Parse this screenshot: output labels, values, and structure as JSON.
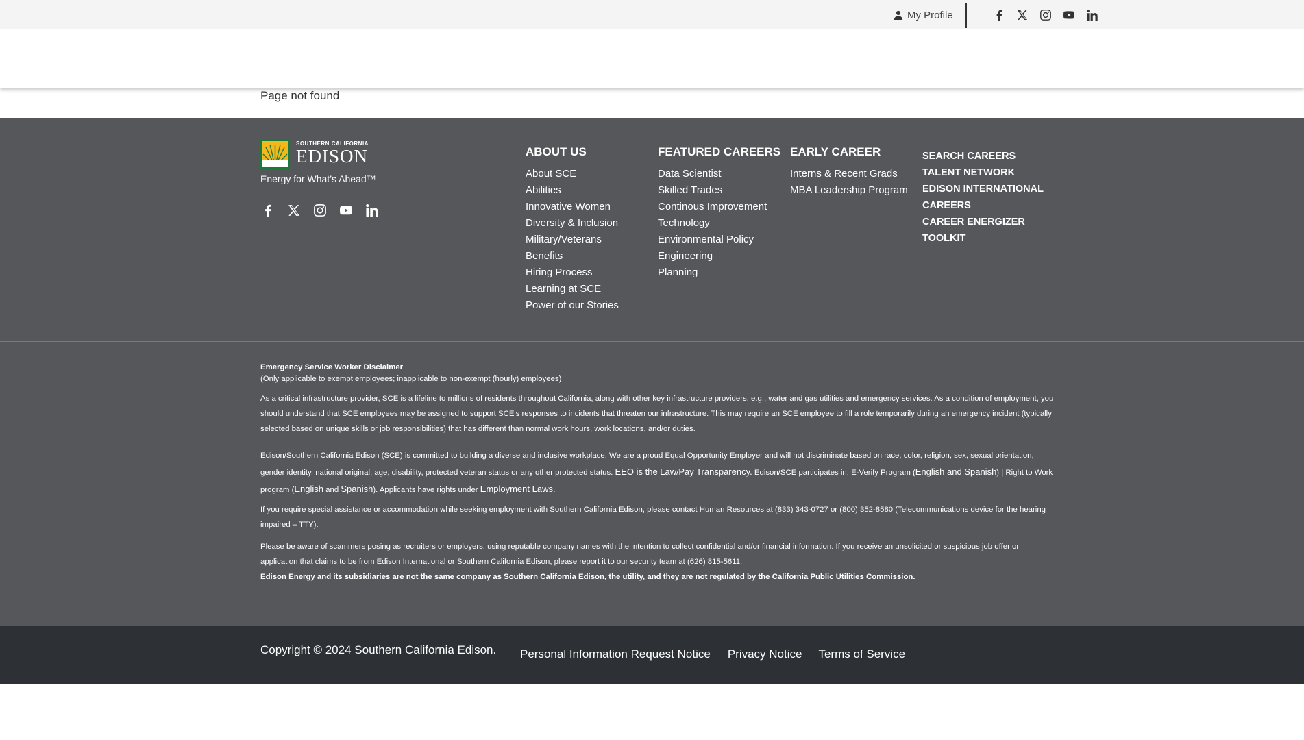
{
  "topbar": {
    "profile_label": "My Profile",
    "social_icons": [
      "facebook-icon",
      "x-icon",
      "instagram-icon",
      "youtube-icon",
      "linkedin-icon"
    ]
  },
  "main": {
    "message": "Page not found"
  },
  "footer": {
    "logo": {
      "small_text": "SOUTHERN CALIFORNIA",
      "name": "EDISON",
      "tagline": "Energy for What’s Ahead™"
    },
    "columns": [
      {
        "heading": "ABOUT US",
        "items": [
          "About SCE",
          "Abilities",
          "Innovative Women",
          "Diversity & Inclusion",
          "Military/Veterans",
          "Benefits",
          "Hiring Process",
          "Learning at SCE",
          "Power of our Stories"
        ]
      },
      {
        "heading": "FEATURED CAREERS",
        "items": [
          "Data Scientist",
          "Skilled Trades",
          "Continous Improvement",
          "Technology",
          "Environmental Policy",
          "Engineering",
          "Planning"
        ]
      },
      {
        "heading": "EARLY CAREER",
        "items": [
          "Interns & Recent Grads",
          "MBA Leadership Program"
        ]
      },
      {
        "heading": "",
        "items": [
          "SEARCH CAREERS",
          "TALENT NETWORK",
          "EDISON INTERNATIONAL CAREERS",
          "CAREER ENERGIZER TOOLKIT"
        ]
      }
    ],
    "legal": {
      "disclaimer_title": "Emergency Service Worker Disclaimer",
      "disclaimer_sub": "(Only applicable to exempt employees; inapplicable to non-exempt (hourly) employees)",
      "para1": "As a critical infrastructure provider, SCE is a lifeline to millions of residents throughout California, along with other key infrastructure providers, e.g., water and gas utilities and emergency services. As a condition of employment, you should understand that SCE employees may be assigned to support SCE's responses to incidents that threaten our infrastructure. This may require an SCE employee to fill a role temporarily during an emergency incident (typically selected based on unique skills or job responsibilities) that has different than normal work hours, work locations, and/or duties.",
      "para2_a": "Edison/Southern California Edison (SCE) is committed to building a diverse and inclusive workplace. We are a proud Equal Opportunity Employer and will not discriminate based on race, color, religion, sex, sexual orientation, gender identity, national original, age, disability, protected veteran status or any other protected status. ",
      "eeo_link": "EEO is the Law",
      "slash": "/",
      "pay_link": "Pay Transparency.",
      "para2_b": " Edison/SCE participates in: E-Verify Program (",
      "everify_link": "English and Spanish",
      "para2_c": ") | Right to Work program (",
      "rtw_english": "English",
      "and": " and ",
      "rtw_spanish": "Spanish",
      "para2_d": "). Applicants have rights under ",
      "employment_link": "Employment Laws.",
      "para3": "If you require special assistance or accommodation while seeking employment with Southern California Edison, please contact Human Resources at (833) 343-0727 or (800) 352-8580 (Telecommunications device for the hearing impaired – TTY).",
      "para4": "Please be aware of scammers posing as recruiters or employers, using reputable company names with the intention to collect confidential and/or financial information. If you receive an unsolicited or suspicious job offer or application that claims to be from Edison International or Southern California Edison, please report it to our security team at (626) 815-5611.",
      "para5": "Edison Energy and its subsidiaries are not the same company as Southern California Edison, the utility, and they are not regulated by the California Public Utilities Commission."
    }
  },
  "bottom": {
    "copyright": "Copyright © 2024 Southern California Edison.",
    "links": [
      "Personal Information Request Notice",
      "Privacy Notice",
      "Terms of Service"
    ]
  },
  "colors": {
    "footer_bg": "#55575b",
    "bottom_bg": "#2d3034",
    "topbar_bg": "#f4f4f4"
  }
}
